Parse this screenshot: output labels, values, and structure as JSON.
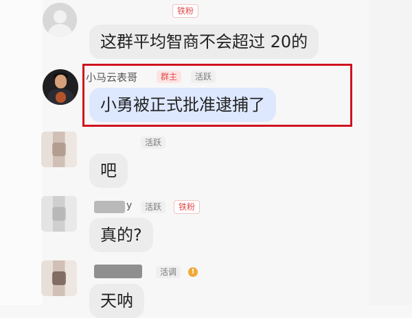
{
  "messages": [
    {
      "name": "",
      "badges": [
        "铁粉"
      ],
      "text": "这群平均智商不会超过 20的"
    },
    {
      "name": "小马云表哥",
      "badges": [
        "群主",
        "活跃"
      ],
      "text": "小勇被正式批准逮捕了"
    },
    {
      "name": "",
      "badges": [
        "活跃"
      ],
      "text": "吧"
    },
    {
      "name": "y",
      "badges": [
        "活跃",
        "铁粉"
      ],
      "text": "真的?"
    },
    {
      "name": "",
      "badges": [
        "活调"
      ],
      "text": "天呐"
    }
  ],
  "colors": {
    "highlight_border": "#d0121e",
    "badge_red": "#e14b4b",
    "bubble": "#ececec",
    "bubble_highlight": "#dde8ff",
    "coin": "#f1a93c"
  },
  "icons": {
    "coin_glyph": "!"
  }
}
